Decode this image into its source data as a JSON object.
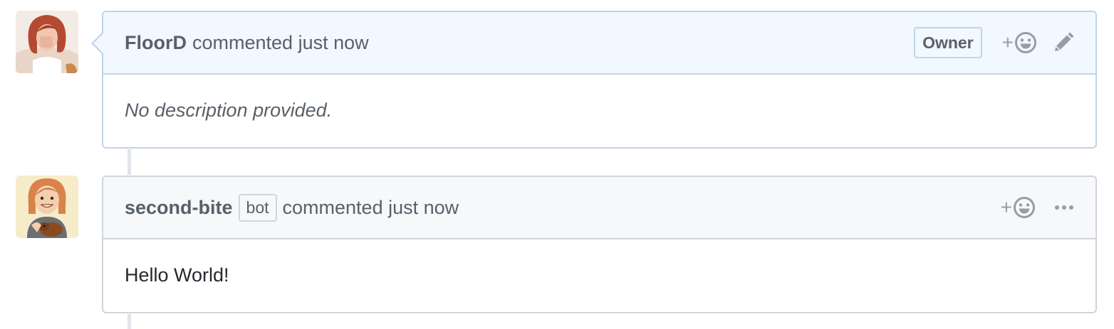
{
  "comments": [
    {
      "author": "FloorD",
      "action": "commented just now",
      "role_badge": "Owner",
      "body": "No description provided.",
      "reaction_plus": "+",
      "avatar_icon": "avatar-red-haired-woman",
      "menu_icon": "pencil-icon"
    },
    {
      "author": "second-bite",
      "bot_badge": "bot",
      "action": "commented just now",
      "body": "Hello World!",
      "reaction_plus": "+",
      "avatar_icon": "avatar-cartoon-girl-with-dog",
      "menu_icon": "kebab-icon"
    }
  ],
  "colors": {
    "owner_header_bg": "#f1f8ff",
    "owner_border": "#c0d3eb",
    "default_header_bg": "#f6f8fa",
    "default_border": "#d1d5da",
    "muted_text": "#586069"
  }
}
